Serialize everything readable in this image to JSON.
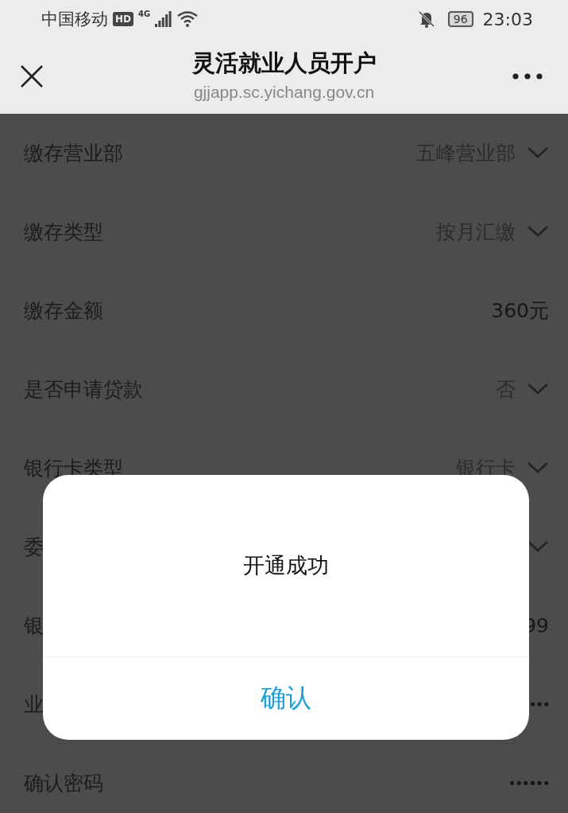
{
  "status_bar": {
    "carrier": "中国移动",
    "hd_badge": "HD",
    "network": "4G",
    "battery": "96",
    "time": "23:03"
  },
  "title_bar": {
    "title": "灵活就业人员开户",
    "subtitle": "gjjapp.sc.yichang.gov.cn"
  },
  "form_rows": [
    {
      "label": "缴存营业部",
      "value": "五峰营业部",
      "kind": "select"
    },
    {
      "label": "缴存类型",
      "value": "按月汇缴",
      "kind": "select"
    },
    {
      "label": "缴存金额",
      "value": "360元",
      "kind": "text"
    },
    {
      "label": "是否申请贷款",
      "value": "否",
      "kind": "select"
    },
    {
      "label": "银行卡类型",
      "value": "银行卡",
      "kind": "select"
    },
    {
      "label": "委",
      "value": "",
      "kind": "select"
    },
    {
      "label": "银",
      "value": "99",
      "kind": "text"
    },
    {
      "label": "业",
      "value": "•••",
      "kind": "password"
    },
    {
      "label": "确认密码",
      "value": "••••••",
      "kind": "password"
    }
  ],
  "dialog": {
    "message": "开通成功",
    "button": "确认"
  }
}
